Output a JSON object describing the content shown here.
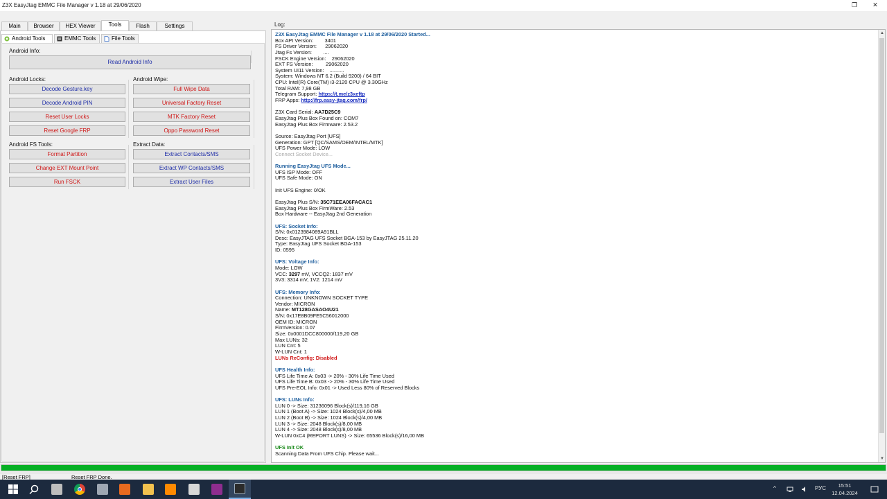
{
  "window": {
    "title": "Z3X EasyJtag EMMC File Manager v 1.18 at 29/06/2020",
    "controls": [
      "❐",
      "✕"
    ]
  },
  "main_tabs": [
    {
      "label": "Main"
    },
    {
      "label": "Browser"
    },
    {
      "label": "HEX Viewer"
    },
    {
      "label": "Tools"
    },
    {
      "label": "Flash"
    },
    {
      "label": "Settings"
    }
  ],
  "sub_tabs": [
    {
      "label": "Android Tools"
    },
    {
      "label": "EMMC Tools"
    },
    {
      "label": "File Tools"
    }
  ],
  "groups": {
    "android_info": {
      "title": "Android Info:",
      "buttons": [
        "Read Android Info"
      ]
    },
    "android_locks": {
      "title": "Android Locks:",
      "buttons": [
        "Decode Gesture.key",
        "Decode Android PIN",
        "Reset User Locks",
        "Reset Google FRP"
      ]
    },
    "android_wipe": {
      "title": "Android Wipe:",
      "buttons": [
        "Full Wipe Data",
        "Universal Factory Reset",
        "MTK Factory Reset",
        "Oppo Password Reset"
      ]
    },
    "android_fs": {
      "title": "Android FS Tools:",
      "buttons": [
        "Format Partition",
        "Change EXT Mount Point",
        "Run FSCK"
      ]
    },
    "extract": {
      "title": "Extract Data:",
      "buttons": [
        "Extract Contacts/SMS",
        "Extract WP Contacts/SMS",
        "Extract User Files"
      ]
    }
  },
  "log": {
    "title": "Log:",
    "lines": [
      {
        "t": "Z3X EasyJtag EMMC File Manager v 1.18 at 29/06/2020 Started...",
        "s": "hdr"
      },
      {
        "t": "Box API Version:        3401"
      },
      {
        "t": "FS Driver Version:      29062020"
      },
      {
        "t": "Jtag Fs Version:        ...."
      },
      {
        "t": "FSCK Engine Version:    29062020"
      },
      {
        "t": "EXT FS Version:         29062020"
      },
      {
        "t": "System UI11 Version:    .........."
      },
      {
        "t": "System: Windows NT 6.2 (Build 9200) / 64 BIT"
      },
      {
        "t": "CPU: Intel(R) Core(TM) i3-2120 CPU @ 3.30GHz"
      },
      {
        "t": "Total RAM: 7,98 GB"
      },
      {
        "t": "Telegram Support: ",
        "link": "https://t.me/z3xeftp"
      },
      {
        "t": "FRP Apps: ",
        "link": "http://frp.easy-jtag.com/frp/"
      },
      {
        "t": ""
      },
      {
        "t": "Z3X Card Serial: ",
        "v": "AA7D25C9"
      },
      {
        "t": "EasyJtag Plus Box Found on: COM7"
      },
      {
        "t": "EasyJtag Plus Box Firmware: 2.53.2"
      },
      {
        "t": ""
      },
      {
        "t": "Source: EasyJtag Port [UFS]"
      },
      {
        "t": "Generation: GPT [QC/SAMS/OEM/INTEL/MTK]"
      },
      {
        "t": "UFS Power Mode: LOW"
      },
      {
        "t": "Connect Socket Device...",
        "s": "gray"
      },
      {
        "t": ""
      },
      {
        "t": "Running EasyJtag UFS Mode...",
        "s": "hdr"
      },
      {
        "t": "UFS ISP Mode: OFF"
      },
      {
        "t": "UFS Safe Mode: ON"
      },
      {
        "t": ""
      },
      {
        "t": "Init UFS Engine: 0/OK"
      },
      {
        "t": ""
      },
      {
        "t": "EasyJtag Plus S/N: ",
        "v": "35C71EEA06FACAC1"
      },
      {
        "t": "EasyJtag Plus Box FirmWare: 2.53"
      },
      {
        "t": "Box Hardware -- EasyJtag 2nd Generation"
      },
      {
        "t": ""
      },
      {
        "t": "UFS: Socket Info:",
        "s": "hdr"
      },
      {
        "t": "S/N: 0x0123984089A91BLL"
      },
      {
        "t": "Desc: EasyJTAG UFS Socket BGA-153 by EasyJTAG 25.11.20"
      },
      {
        "t": "Type: EasyJtag UFS Socket BGA-153"
      },
      {
        "t": "ID: 0595"
      },
      {
        "t": ""
      },
      {
        "t": "UFS: Voltage Info:",
        "s": "hdr"
      },
      {
        "t": "Mode: LOW"
      },
      {
        "t": "VCC: ",
        "v": "3297",
        "r": " mV, VCCQ2: 1837 mV"
      },
      {
        "t": "3V3: 3314 mV, 1V2: 1214 mV"
      },
      {
        "t": ""
      },
      {
        "t": "UFS: Memory Info:",
        "s": "hdr"
      },
      {
        "t": "Connection: UNKNOWN SOCKET TYPE"
      },
      {
        "t": "Vendor: MICRON"
      },
      {
        "t": "Name: ",
        "v": "MT128GASAO4U21"
      },
      {
        "t": "S/N: 0x17E8B09FE5C56012000"
      },
      {
        "t": "OEM ID: MICRON"
      },
      {
        "t": "FirmVersion: 0.07"
      },
      {
        "t": "Size: 0x0001DCC800000/119,20 GB"
      },
      {
        "t": "Max LUNs: 32"
      },
      {
        "t": "LUN Cnt: 5"
      },
      {
        "t": "W-LUN Cnt: 1"
      },
      {
        "t": "LUNs ReConfig: Disabled",
        "s": "red"
      },
      {
        "t": ""
      },
      {
        "t": "UFS Health Info:",
        "s": "hdr"
      },
      {
        "t": "UFS Life Time A: 0x03 -> 20% - 30% Life Time Used"
      },
      {
        "t": "UFS Life Time B: 0x03 -> 20% - 30% Life Time Used"
      },
      {
        "t": "UFS Pre-EOL Info: 0x01 -> Used Less 80% of Reserved Blocks"
      },
      {
        "t": ""
      },
      {
        "t": "UFS: LUNs Info:",
        "s": "hdr"
      },
      {
        "t": "LUN 0 -> Size: 31236096 Block(s)/119,16 GB"
      },
      {
        "t": "LUN 1 (Boot A) -> Size: 1024 Block(s)/4,00 MB"
      },
      {
        "t": "LUN 2 (Boot B) -> Size: 1024 Block(s)/4,00 MB"
      },
      {
        "t": "LUN 3 -> Size: 2048 Block(s)/8,00 MB"
      },
      {
        "t": "LUN 4 -> Size: 2048 Block(s)/8,00 MB"
      },
      {
        "t": "W-LUN 0xC4 (REPORT LUNS) -> Size: 65536 Block(s)/16,00 MB"
      },
      {
        "t": ""
      },
      {
        "t": "UFS Init OK",
        "s": "green"
      },
      {
        "t": "Scanning Data From UFS Chip. Please wait..."
      }
    ]
  },
  "progress": {
    "percent": 100,
    "color": "#06b025"
  },
  "status": {
    "left": "[Reset FRP]",
    "right": "Reset FRP Done."
  },
  "taskbar": {
    "apps": [
      {
        "name": "windows-start-icon",
        "color": "#ffffff"
      },
      {
        "name": "search-icon",
        "color": "#ffffff"
      },
      {
        "name": "z3x-app-icon",
        "color": "#bdbdbd"
      },
      {
        "name": "chrome-icon",
        "color": "#e0452f"
      },
      {
        "name": "usb-tool-icon",
        "color": "#9ea7b3"
      },
      {
        "name": "flash-tool-icon",
        "color": "#e86a1f"
      },
      {
        "name": "file-explorer-icon",
        "color": "#f2c14e"
      },
      {
        "name": "firefox-icon",
        "color": "#ff8a00"
      },
      {
        "name": "storage-app-icon",
        "color": "#d8d8d8"
      },
      {
        "name": "winrar-icon",
        "color": "#8e2d8e"
      },
      {
        "name": "easyjtag-icon",
        "color": "#2b2b2b"
      }
    ],
    "tray": {
      "chevron": "^",
      "lang": "РУС",
      "time": "15:51",
      "date": "12.04.2024"
    }
  }
}
